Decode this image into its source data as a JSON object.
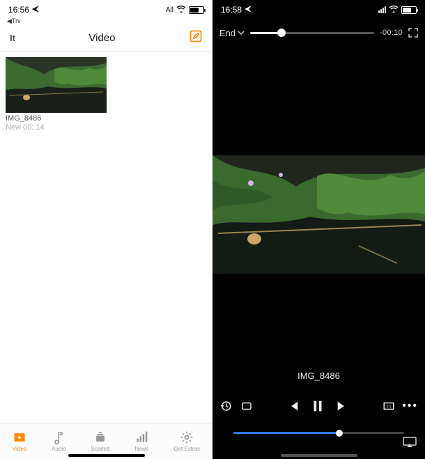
{
  "left": {
    "status": {
      "time": "16:56",
      "back_hint": "◀Trv",
      "net_label": "All"
    },
    "header": {
      "back": "It",
      "title": "Video"
    },
    "item": {
      "filename": "IMG_8486",
      "meta": "New 00: 14"
    },
    "tabs": [
      {
        "label": "Video",
        "icon": "play"
      },
      {
        "label": "Audio",
        "icon": "music"
      },
      {
        "label": "Scarlett",
        "icon": "stack"
      },
      {
        "label": "News",
        "icon": "bars"
      },
      {
        "label": "Get Extras",
        "icon": "gear"
      }
    ]
  },
  "right": {
    "status": {
      "time": "16:58"
    },
    "top": {
      "label": "End",
      "time_remaining": "-00:10"
    },
    "video_title": "IMG_8486",
    "seek_pct": 62,
    "vol_pct": 25
  },
  "colors": {
    "accent": "#ff8a00",
    "seek": "#2a7fff"
  }
}
